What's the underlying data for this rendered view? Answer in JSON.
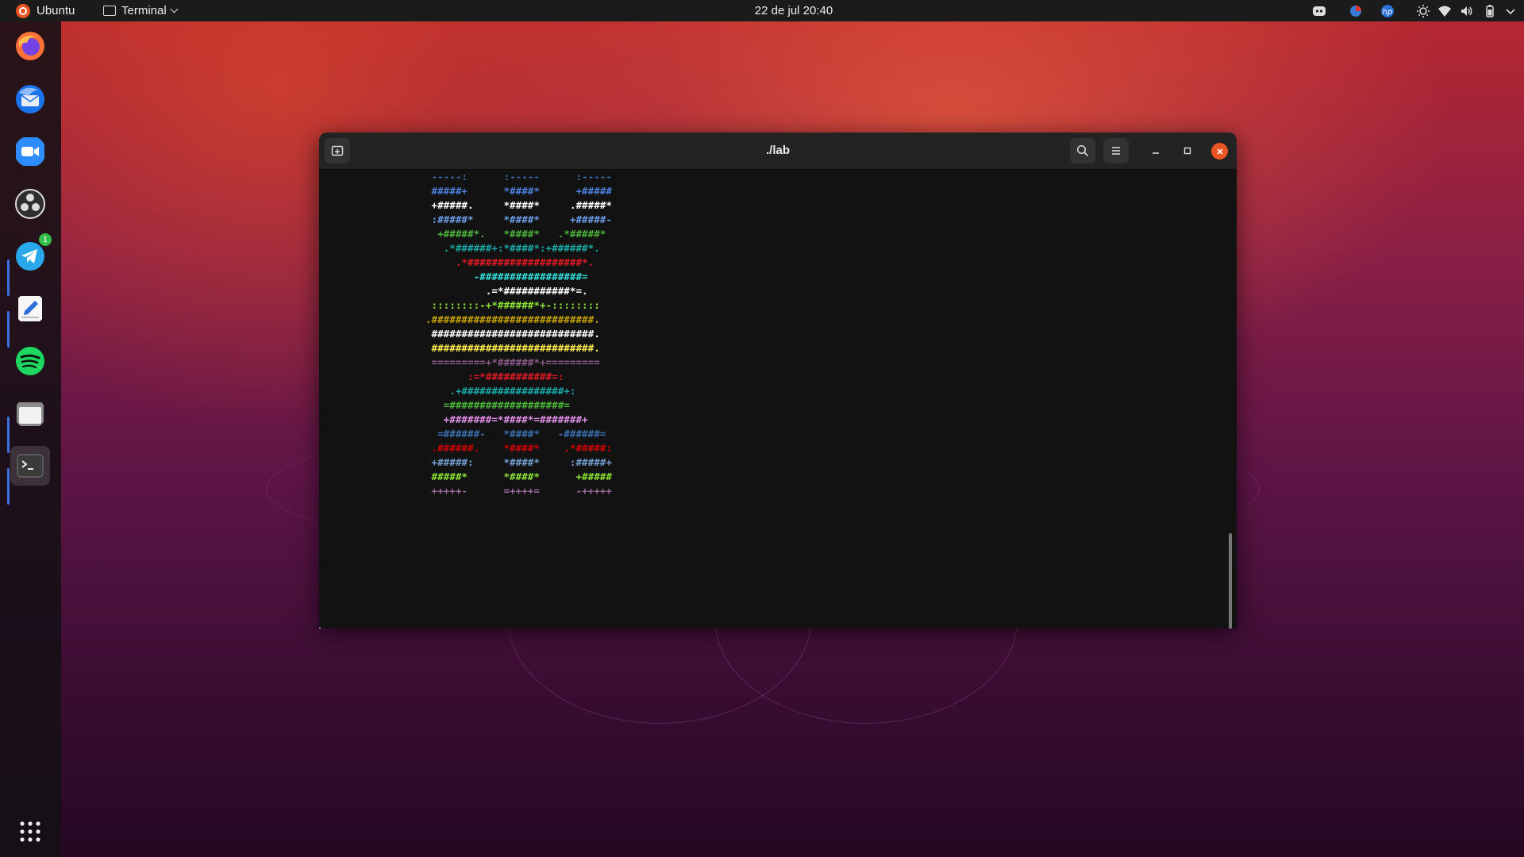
{
  "topbar": {
    "activities_label": "Ubuntu",
    "app_menu_label": "Terminal",
    "clock": "22 de jul  20:40"
  },
  "dock": {
    "apps": [
      "firefox",
      "thunderbird",
      "zoom",
      "obs-studio",
      "telegram",
      "text-editor",
      "spotify",
      "files",
      "terminal"
    ],
    "telegram_badge": "1"
  },
  "window": {
    "title": "./lab"
  },
  "terminal": {
    "lines": [
      {
        "text": "      -----:      :-----      :-----",
        "color": "#3a6fb0"
      },
      {
        "text": "      #####+      *####*      +#####",
        "color": "#4a7fd8"
      },
      {
        "text": "      +#####.     *####*     .#####*",
        "color": "#ffffff"
      },
      {
        "text": "      :#####*     *####*     +#####-",
        "color": "#6a9ae8"
      },
      {
        "text": "       +#####*.   *####*   .*#####*",
        "color": "#4bb23a"
      },
      {
        "text": "        .*######+:*####*:+######*.",
        "color": "#17a5a5"
      },
      {
        "text": "          .*###################*.",
        "color": "#e01b24"
      },
      {
        "text": "             -#################=",
        "color": "#33dddd"
      },
      {
        "text": "               .=*###########*=.",
        "color": "#ffffff"
      },
      {
        "text": "      ::::::::-+*######*+-::::::::",
        "color": "#8ae234"
      },
      {
        "text": "     .###########################.",
        "color": "#c4a000"
      },
      {
        "text": "      ###########################.",
        "color": "#ffffff"
      },
      {
        "text": "      ###########################.",
        "color": "#fce94f"
      },
      {
        "text": "      =========+*######*+=========",
        "color": "#8a5a8a"
      },
      {
        "text": "            :=*###########=:",
        "color": "#e01b24"
      },
      {
        "text": "         .+#################+:",
        "color": "#17a5a5"
      },
      {
        "text": "        =###################=",
        "color": "#4bb23a"
      },
      {
        "text": "        +#######=*####*=#######+",
        "color": "#e28de8"
      },
      {
        "text": "       =######-   *####*   -######=",
        "color": "#3a6fb0"
      },
      {
        "text": "      .######.    *####*    .*#####:",
        "color": "#cc0000"
      },
      {
        "text": "      +#####:     *####*     :#####+",
        "color": "#729fcf"
      },
      {
        "text": "      #####*      *####*      +#####",
        "color": "#8ae234"
      },
      {
        "text": "      +++++-      =++++=      -+++++",
        "color": "#9a6a9a"
      }
    ]
  }
}
